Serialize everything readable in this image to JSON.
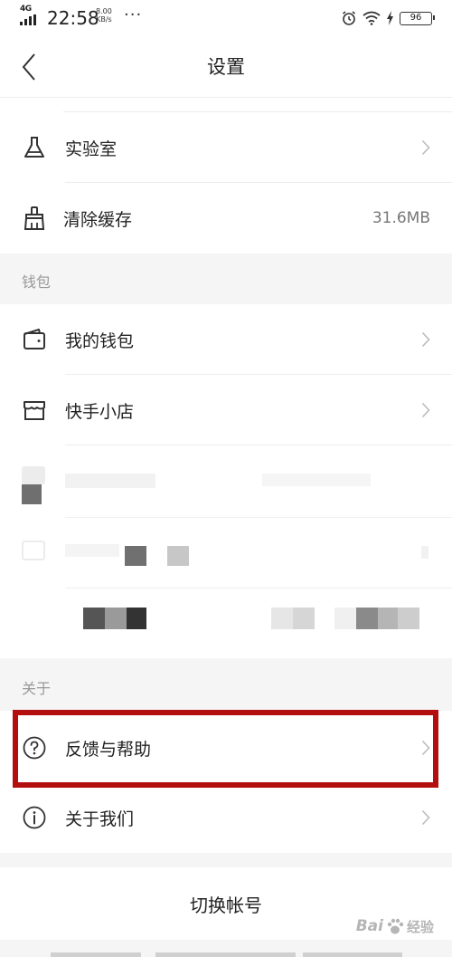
{
  "status_bar": {
    "network": "4G",
    "time": "22:58",
    "speed_value": "8.00",
    "speed_unit": "KB/s",
    "more": "···",
    "battery": "96"
  },
  "nav": {
    "title": "设置"
  },
  "rows": {
    "lab": {
      "label": "实验室"
    },
    "clear_cache": {
      "label": "清除缓存",
      "value": "31.6MB"
    },
    "wallet": {
      "label": "我的钱包"
    },
    "shop": {
      "label": "快手小店"
    },
    "feedback": {
      "label": "反馈与帮助"
    },
    "about_us": {
      "label": "关于我们"
    }
  },
  "sections": {
    "wallet": "钱包",
    "about": "关于"
  },
  "switch_account": "切换帐号",
  "watermark": {
    "text": "Bai",
    "suffix": "经验"
  },
  "colors": {
    "highlight": "#b30f0f",
    "section_bg": "#f5f5f5",
    "divider": "#ececec",
    "text": "#222222",
    "muted": "#999999"
  }
}
